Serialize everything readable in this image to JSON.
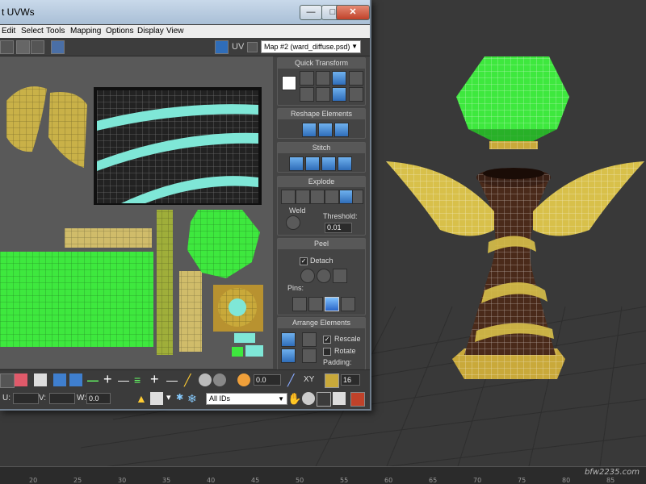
{
  "window": {
    "title": "t UVWs",
    "minimize": "—",
    "maximize": "□",
    "close": "✕"
  },
  "menu": [
    "Edit",
    "Select",
    "Tools",
    "Mapping",
    "Options",
    "Display",
    "View"
  ],
  "toolbar": {
    "uv_label": "UV",
    "map_select": "Map #2 (ward_diffuse.psd)"
  },
  "panel": {
    "quick_transform": "Quick Transform",
    "reshape_elements": "Reshape Elements",
    "stitch": "Stitch",
    "explode": "Explode",
    "weld_label": "Weld",
    "threshold_label": "Threshold:",
    "threshold_value": "0.01",
    "peel": "Peel",
    "detach_label": "Detach",
    "detach_checked": "✓",
    "pins_label": "Pins:",
    "arrange_elements": "Arrange Elements",
    "rescale_label": "Rescale",
    "rescale_checked": "✓",
    "rotate_label": "Rotate",
    "padding_label": "Padding:"
  },
  "bottom": {
    "value_a": "0.0",
    "xy_label": "XY",
    "value_b": "16",
    "u_label": "U:",
    "v_label": "V:",
    "w_label": "W:",
    "w_value": "0.0",
    "ids_select": "All IDs"
  },
  "ruler": {
    "ticks": [
      "20",
      "25",
      "30",
      "35",
      "40",
      "45",
      "50",
      "55",
      "60",
      "65",
      "70",
      "75",
      "80",
      "85"
    ]
  },
  "watermark": "bfw2235.com",
  "colors": {
    "uv_green": "#3ee83e",
    "uv_yellow": "#d8c04a",
    "uv_cyan": "#7fe7d7",
    "wood": "#4a2a1a",
    "accent_blue": "#2f6db9"
  }
}
